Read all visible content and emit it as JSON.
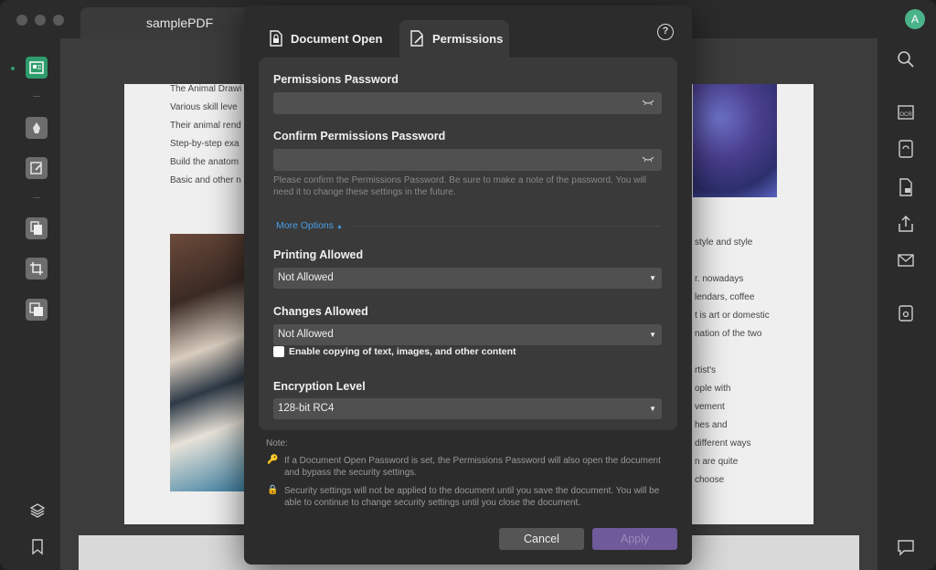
{
  "window": {
    "doc_tab_title": "samplePDF",
    "avatar_letter": "A"
  },
  "page": {
    "left_lines": [
      "The Animal Drawi",
      "Various skill leve",
      "Their animal rend",
      "Step-by-step exa",
      "Build the anatom",
      "Basic and other n"
    ],
    "right_lines": [
      "style and style",
      "r. nowadays",
      "lendars, coffee",
      "t is art or domestic",
      "nation of the two",
      "rtist's",
      "ople with",
      "vement",
      "hes and",
      "different ways",
      "n are quite",
      "choose"
    ]
  },
  "dialog": {
    "tabs": [
      {
        "label": "Document Open",
        "icon": "lock-document-icon"
      },
      {
        "label": "Permissions",
        "icon": "edit-document-icon"
      }
    ],
    "help_label": "?",
    "permissions_password_label": "Permissions Password",
    "permissions_password_value": "",
    "confirm_password_label": "Confirm Permissions Password",
    "confirm_password_value": "",
    "confirm_hint": "Please confirm the Permissions Password. Be sure to make a note of the password. You will need it to change these settings in the future.",
    "more_options_label": "More Options",
    "printing_label": "Printing Allowed",
    "printing_value": "Not Allowed",
    "changes_label": "Changes Allowed",
    "changes_value": "Not Allowed",
    "copy_checkbox_label": "Enable copying of text, images, and other content",
    "copy_checked": false,
    "encryption_label": "Encryption Level",
    "encryption_value": "128-bit RC4",
    "note_title": "Note:",
    "note_1": "If a Document Open Password is set, the Permissions Password will also open the document and bypass the security settings.",
    "note_2": "Security settings will not be applied to the document until you save the document. You will be able to continue to change security settings until you close the document.",
    "cancel_label": "Cancel",
    "apply_label": "Apply"
  },
  "colors": {
    "accent_green": "#2e9c6c",
    "link_blue": "#4a9fe6",
    "apply_purple": "#6f5a9a"
  }
}
